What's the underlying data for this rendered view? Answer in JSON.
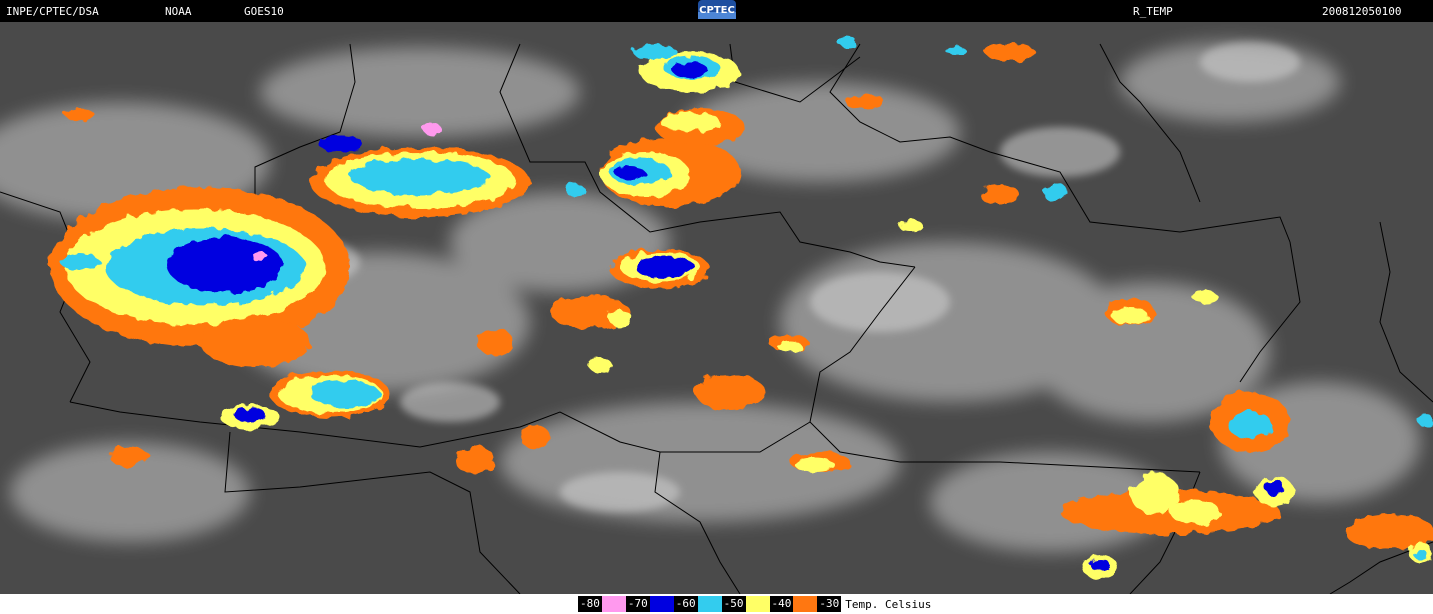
{
  "header": {
    "source": "INPE/CPTEC/DSA",
    "agency": "NOAA",
    "satellite": "GOES10",
    "logo_text": "CPTEC",
    "product": "R_TEMP",
    "datetime": "200812050100"
  },
  "legend": {
    "items": [
      {
        "label": "-80",
        "color": "#ff99ee"
      },
      {
        "label": "-70",
        "color": "#0000e0"
      },
      {
        "label": "-60",
        "color": "#33ccee"
      },
      {
        "label": "-50",
        "color": "#ffff66"
      },
      {
        "label": "-40",
        "color": "#ff7711"
      },
      {
        "label": "-30",
        "color": null
      }
    ],
    "unit": "Temp. Celsius"
  },
  "colors": {
    "background": "#4a4a4a",
    "clouds": "#b9b9b9",
    "borders": "#000000"
  }
}
